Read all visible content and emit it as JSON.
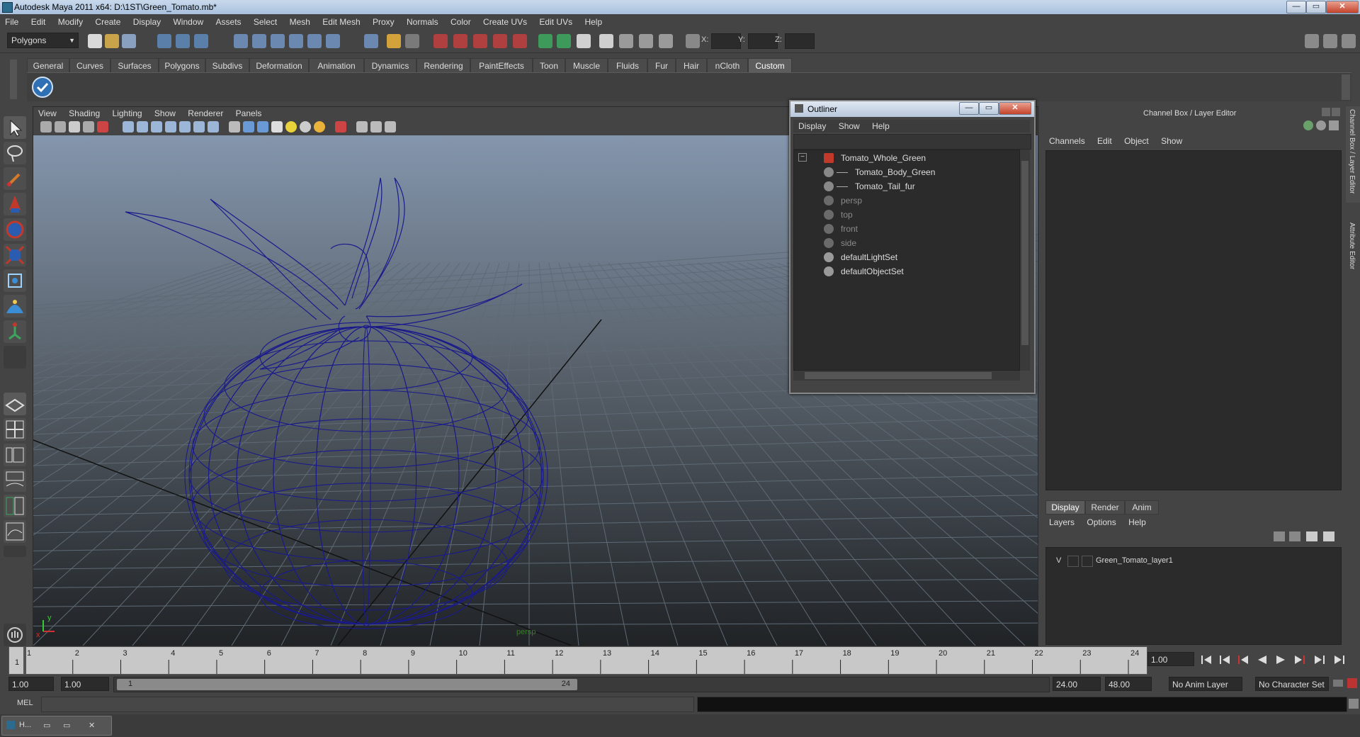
{
  "window": {
    "title": "Autodesk Maya 2011 x64: D:\\1ST\\Green_Tomato.mb*",
    "min_label": "—",
    "max_label": "▭",
    "close_label": "✕"
  },
  "menubar": [
    "File",
    "Edit",
    "Modify",
    "Create",
    "Display",
    "Window",
    "Assets",
    "Select",
    "Mesh",
    "Edit Mesh",
    "Proxy",
    "Normals",
    "Color",
    "Create UVs",
    "Edit UVs",
    "Help"
  ],
  "statusline": {
    "mode": "Polygons",
    "x_label": "X:",
    "y_label": "Y:",
    "z_label": "Z:"
  },
  "shelf": {
    "tabs": [
      "General",
      "Curves",
      "Surfaces",
      "Polygons",
      "Subdivs",
      "Deformation",
      "Animation",
      "Dynamics",
      "Rendering",
      "PaintEffects",
      "Toon",
      "Muscle",
      "Fluids",
      "Fur",
      "Hair",
      "nCloth",
      "Custom"
    ],
    "active_tab": "Custom"
  },
  "viewport": {
    "menu": [
      "View",
      "Shading",
      "Lighting",
      "Show",
      "Renderer",
      "Panels"
    ],
    "camera_label": "persp",
    "axis_x": "x",
    "axis_y": "y"
  },
  "outliner": {
    "title": "Outliner",
    "menu": [
      "Display",
      "Show",
      "Help"
    ],
    "items": [
      {
        "label": "Tomato_Whole_Green",
        "indent": 0,
        "dim": false
      },
      {
        "label": "Tomato_Body_Green",
        "indent": 1,
        "dim": false
      },
      {
        "label": "Tomato_Tail_fur",
        "indent": 1,
        "dim": false
      },
      {
        "label": "persp",
        "indent": 0,
        "dim": true
      },
      {
        "label": "top",
        "indent": 0,
        "dim": true
      },
      {
        "label": "front",
        "indent": 0,
        "dim": true
      },
      {
        "label": "side",
        "indent": 0,
        "dim": true
      },
      {
        "label": "defaultLightSet",
        "indent": 0,
        "dim": false
      },
      {
        "label": "defaultObjectSet",
        "indent": 0,
        "dim": false
      }
    ],
    "collapse_glyph": "−"
  },
  "channelbox": {
    "title": "Channel Box / Layer Editor",
    "menu": [
      "Channels",
      "Edit",
      "Object",
      "Show"
    ],
    "layer_tabs": [
      "Display",
      "Render",
      "Anim"
    ],
    "active_layer_tab": "Display",
    "layer_menu": [
      "Layers",
      "Options",
      "Help"
    ],
    "layer": {
      "visible": "V",
      "name": "Green_Tomato_layer1"
    },
    "side_tabs": [
      "Channel Box / Layer Editor",
      "Attribute Editor"
    ]
  },
  "timeline": {
    "start": 1,
    "end": 24,
    "current": 1,
    "current_field": "1.00"
  },
  "range": {
    "start_time": "1.00",
    "playback_start": "1.00",
    "slider_start": "1",
    "slider_end": "24",
    "playback_end": "24.00",
    "end_time": "48.00",
    "anim_layer": "No Anim Layer",
    "character_set": "No Character Set"
  },
  "cmdline": {
    "label": "MEL"
  },
  "taskbar": {
    "item_label": "H..."
  },
  "colors": {
    "wireframe": "#1a1a8c",
    "grid": "#5e6a75",
    "viewport_top": "#8496ad",
    "viewport_bottom": "#202326"
  }
}
